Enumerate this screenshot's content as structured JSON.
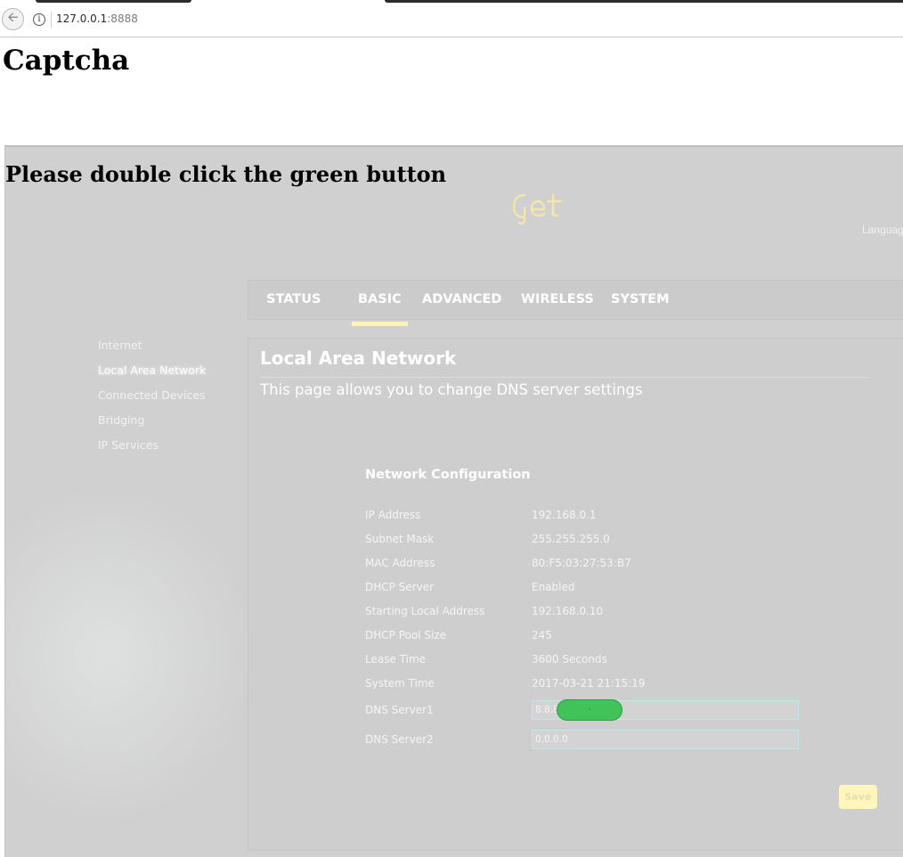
{
  "browser": {
    "url_host": "127.0.0.1",
    "url_port": ":8888"
  },
  "page": {
    "title": "Captcha",
    "instruction": "Please double click the green button"
  },
  "router": {
    "logo_text": "get",
    "language_label": "Language",
    "nav": [
      {
        "label": "STATUS",
        "active": false
      },
      {
        "label": "BASIC",
        "active": true
      },
      {
        "label": "ADVANCED",
        "active": false
      },
      {
        "label": "WIRELESS",
        "active": false
      },
      {
        "label": "SYSTEM",
        "active": false
      }
    ],
    "sidebar": [
      {
        "label": "Internet",
        "active": false
      },
      {
        "label": "Local Area Network",
        "active": true
      },
      {
        "label": "Connected Devices",
        "active": false
      },
      {
        "label": "Bridging",
        "active": false
      },
      {
        "label": "IP Services",
        "active": false
      }
    ],
    "panel": {
      "title": "Local Area Network",
      "description": "This page allows you to change DNS server settings",
      "section_title": "Network Configuration",
      "rows": [
        {
          "label": "IP Address",
          "value": "192.168.0.1"
        },
        {
          "label": "Subnet Mask",
          "value": "255.255.255.0"
        },
        {
          "label": "MAC Address",
          "value": "80:F5:03:27:53:B7"
        },
        {
          "label": "DHCP Server",
          "value": "Enabled"
        },
        {
          "label": "Starting Local Address",
          "value": "192.168.0.10"
        },
        {
          "label": "DHCP Pool Size",
          "value": "245"
        },
        {
          "label": "Lease Time",
          "value": "3600  Seconds"
        },
        {
          "label": "System Time",
          "value": "2017-03-21 21:15:19"
        }
      ],
      "dns1_label": "DNS Server1",
      "dns1_value": "8.8.8",
      "dns2_label": "DNS Server2",
      "dns2_value": "0.0.0.0",
      "green_button_label": ".",
      "save_label": "Save"
    }
  },
  "colors": {
    "frame_bg": "#d0d0d0",
    "green_button": "#41c35a",
    "active_tab_underline": "#fff3b8",
    "save_button": "#fff6bd",
    "logo": "#f3e6a8"
  }
}
